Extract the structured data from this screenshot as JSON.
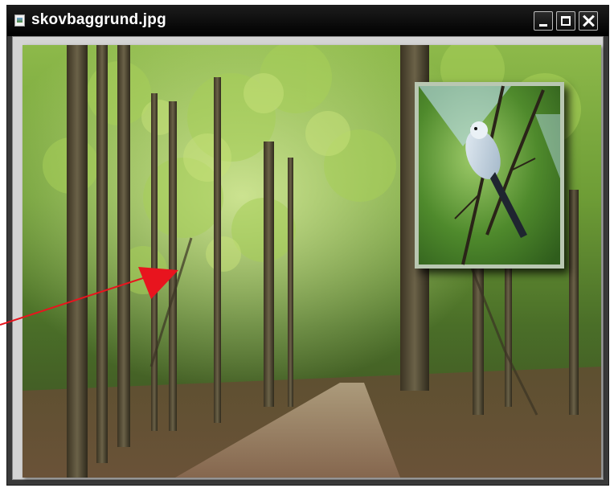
{
  "window": {
    "title": "skovbaggrund.jpg",
    "icons": {
      "app": "image-file-icon",
      "minimize": "minimize-icon",
      "maximize": "maximize-icon",
      "close": "close-icon"
    }
  },
  "content": {
    "main_image": "forest-path-photo",
    "inset_image": "bird-on-branch-photo",
    "annotation": "red-arrow-pointer"
  },
  "colors": {
    "titlebar": "#000000",
    "title_text": "#ffffff",
    "arrow": "#e8141e"
  }
}
